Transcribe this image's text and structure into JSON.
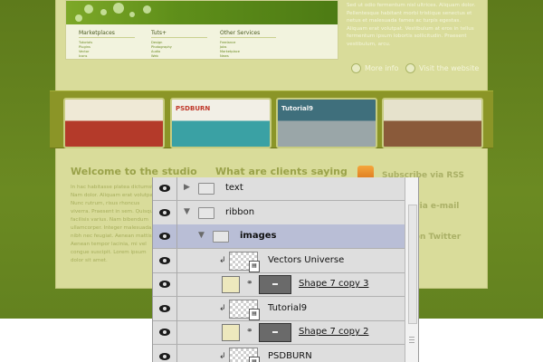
{
  "side_text": "Sed ut odio fermentum nisl ultrices. Aliquam dolor. Pellentesque habitant morbi tristique senectus et netus et malesuada fames ac turpis egestas. Aliquam erat volutpat. Vestibulum at eros in tellus fermentum ipsum lobortis sollicitudin. Praesent vestibulum, arcu.",
  "buttons": {
    "more_info": "More info",
    "visit_website": "Visit the website"
  },
  "hero": {
    "columns": [
      {
        "title": "Marketplaces",
        "items": [
          "Tutorials",
          "Plugins",
          "Vector",
          "Icons"
        ]
      },
      {
        "title": "Tuts+",
        "items": [
          "Design",
          "Photography",
          "Audio",
          "Web"
        ]
      },
      {
        "title": "Other Services",
        "items": [
          "Freelance",
          "Jobs",
          "Marketplace",
          "News"
        ]
      }
    ]
  },
  "thumbs": [
    {
      "label": "",
      "colors": [
        "#efe9d6",
        "#b43a2a"
      ]
    },
    {
      "label": "PSDBURN",
      "colors": [
        "#f2efe6",
        "#3aa1a4"
      ]
    },
    {
      "label": "Tutorial9",
      "colors": [
        "#3f6f7c",
        "#9aa6a8"
      ]
    },
    {
      "label": "",
      "colors": [
        "#e6e2cc",
        "#8a5a3a"
      ]
    }
  ],
  "welcome_heading": "Welcome to the studio",
  "welcome_text": "In hac habitasse platea dictumst. Nam dolor. Aliquam erat volutpat. Nunc rutrum, risus rhoncus viverra. Praesent in sem. Quisque facilisis varius. Nam bibendum ullamcorper. Integer malesuada, nibh nec feugiat. Aenean mattis. Aenean tempor lacinia, mi vel congue suscipit. Lorem ipsum dolor sit amet.",
  "clients_heading": "What are clients saying",
  "social": {
    "rss": "Subscribe via RSS",
    "email": "Follow via e-mail",
    "twitter": "Follow on Twitter"
  },
  "layers": [
    {
      "name": "text",
      "type": "group",
      "expanded": false,
      "level": 0,
      "bold": false,
      "underline": false,
      "selected": false
    },
    {
      "name": "ribbon",
      "type": "group",
      "expanded": true,
      "level": 0,
      "bold": false,
      "underline": false,
      "selected": false
    },
    {
      "name": "images",
      "type": "group",
      "expanded": true,
      "level": 1,
      "bold": true,
      "underline": false,
      "selected": true
    },
    {
      "name": "Vectors Universe",
      "type": "smart",
      "level": 2,
      "bold": false,
      "underline": false,
      "selected": false
    },
    {
      "name": "Shape 7 copy 3",
      "type": "shape",
      "level": 2,
      "bold": false,
      "underline": true,
      "selected": false
    },
    {
      "name": "Tutorial9",
      "type": "smart",
      "level": 2,
      "bold": false,
      "underline": false,
      "selected": false
    },
    {
      "name": "Shape 7 copy 2",
      "type": "shape",
      "level": 2,
      "bold": false,
      "underline": true,
      "selected": false
    },
    {
      "name": "PSDBURN",
      "type": "smart",
      "level": 2,
      "bold": false,
      "underline": false,
      "selected": false
    }
  ],
  "colors": {
    "accent": "#6b8a22",
    "page": "#d9dc9a",
    "selection": "#b9bed6"
  }
}
